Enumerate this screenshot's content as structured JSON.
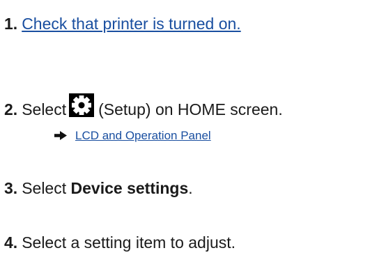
{
  "steps": [
    {
      "number": "1.",
      "link_text": "Check that printer is turned on."
    },
    {
      "number": "2.",
      "text_before": "Select",
      "icon": "gear-icon",
      "text_after": "(Setup) on HOME screen."
    },
    {
      "number": "3.",
      "text_before": "Select ",
      "bold": "Device settings",
      "text_after": "."
    },
    {
      "number": "4.",
      "text": "Select a setting item to adjust."
    }
  ],
  "sublink": {
    "icon": "right-arrow-icon",
    "text": "LCD and Operation Panel"
  },
  "colors": {
    "link": "#1a4fa0",
    "text": "#1a1a1a",
    "icon_bg": "#000000"
  }
}
